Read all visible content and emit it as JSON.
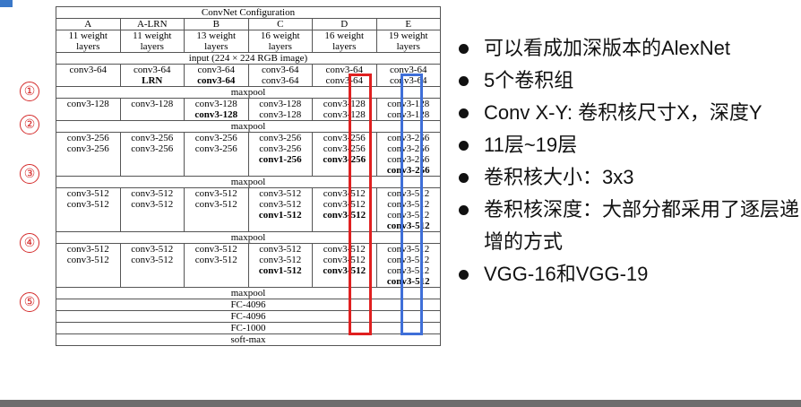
{
  "table": {
    "title": "ConvNet Configuration",
    "columns": [
      "A",
      "A-LRN",
      "B",
      "C",
      "D",
      "E"
    ],
    "depths": [
      [
        "11 weight",
        "layers"
      ],
      [
        "11 weight",
        "layers"
      ],
      [
        "13 weight",
        "layers"
      ],
      [
        "16 weight",
        "layers"
      ],
      [
        "16 weight",
        "layers"
      ],
      [
        "19 weight",
        "layers"
      ]
    ],
    "input": "input (224 × 224 RGB image)",
    "blocks": [
      {
        "cells": [
          [
            {
              "t": "conv3-64"
            }
          ],
          [
            {
              "t": "conv3-64"
            },
            {
              "t": "LRN",
              "b": true
            }
          ],
          [
            {
              "t": "conv3-64"
            },
            {
              "t": "conv3-64",
              "b": true
            }
          ],
          [
            {
              "t": "conv3-64"
            },
            {
              "t": "conv3-64"
            }
          ],
          [
            {
              "t": "conv3-64"
            },
            {
              "t": "conv3-64"
            }
          ],
          [
            {
              "t": "conv3-64"
            },
            {
              "t": "conv3-64"
            }
          ]
        ],
        "pool": "maxpool"
      },
      {
        "cells": [
          [
            {
              "t": "conv3-128"
            }
          ],
          [
            {
              "t": "conv3-128"
            }
          ],
          [
            {
              "t": "conv3-128"
            },
            {
              "t": "conv3-128",
              "b": true
            }
          ],
          [
            {
              "t": "conv3-128"
            },
            {
              "t": "conv3-128"
            }
          ],
          [
            {
              "t": "conv3-128"
            },
            {
              "t": "conv3-128"
            }
          ],
          [
            {
              "t": "conv3-128"
            },
            {
              "t": "conv3-128"
            }
          ]
        ],
        "pool": "maxpool"
      },
      {
        "cells": [
          [
            {
              "t": "conv3-256"
            },
            {
              "t": "conv3-256"
            }
          ],
          [
            {
              "t": "conv3-256"
            },
            {
              "t": "conv3-256"
            }
          ],
          [
            {
              "t": "conv3-256"
            },
            {
              "t": "conv3-256"
            }
          ],
          [
            {
              "t": "conv3-256"
            },
            {
              "t": "conv3-256"
            },
            {
              "t": "conv1-256",
              "b": true
            }
          ],
          [
            {
              "t": "conv3-256"
            },
            {
              "t": "conv3-256"
            },
            {
              "t": "conv3-256",
              "b": true
            }
          ],
          [
            {
              "t": "conv3-256"
            },
            {
              "t": "conv3-256"
            },
            {
              "t": "conv3-256"
            },
            {
              "t": "conv3-256",
              "b": true
            }
          ]
        ],
        "pool": "maxpool"
      },
      {
        "cells": [
          [
            {
              "t": "conv3-512"
            },
            {
              "t": "conv3-512"
            }
          ],
          [
            {
              "t": "conv3-512"
            },
            {
              "t": "conv3-512"
            }
          ],
          [
            {
              "t": "conv3-512"
            },
            {
              "t": "conv3-512"
            }
          ],
          [
            {
              "t": "conv3-512"
            },
            {
              "t": "conv3-512"
            },
            {
              "t": "conv1-512",
              "b": true
            }
          ],
          [
            {
              "t": "conv3-512"
            },
            {
              "t": "conv3-512"
            },
            {
              "t": "conv3-512",
              "b": true
            }
          ],
          [
            {
              "t": "conv3-512"
            },
            {
              "t": "conv3-512"
            },
            {
              "t": "conv3-512"
            },
            {
              "t": "conv3-512",
              "b": true
            }
          ]
        ],
        "pool": "maxpool"
      },
      {
        "cells": [
          [
            {
              "t": "conv3-512"
            },
            {
              "t": "conv3-512"
            }
          ],
          [
            {
              "t": "conv3-512"
            },
            {
              "t": "conv3-512"
            }
          ],
          [
            {
              "t": "conv3-512"
            },
            {
              "t": "conv3-512"
            }
          ],
          [
            {
              "t": "conv3-512"
            },
            {
              "t": "conv3-512"
            },
            {
              "t": "conv1-512",
              "b": true
            }
          ],
          [
            {
              "t": "conv3-512"
            },
            {
              "t": "conv3-512"
            },
            {
              "t": "conv3-512",
              "b": true
            }
          ],
          [
            {
              "t": "conv3-512"
            },
            {
              "t": "conv3-512"
            },
            {
              "t": "conv3-512"
            },
            {
              "t": "conv3-512",
              "b": true
            }
          ]
        ],
        "pool": "maxpool"
      }
    ],
    "tail": [
      "FC-4096",
      "FC-4096",
      "FC-1000",
      "soft-max"
    ]
  },
  "group_numbers": [
    "①",
    "②",
    "③",
    "④",
    "⑤"
  ],
  "bullets": [
    "可以看成加深版本的AlexNet",
    "5个卷积组",
    "Conv X-Y: 卷积核尺寸X，深度Y",
    "11层~19层",
    "卷积核大小：3x3",
    "卷积核深度：大部分都采用了逐层递增的方式",
    "VGG-16和VGG-19"
  ],
  "colors": {
    "highlight_d": "#e02020",
    "highlight_e": "#3f6fd8",
    "group_number": "#d42a2a"
  }
}
